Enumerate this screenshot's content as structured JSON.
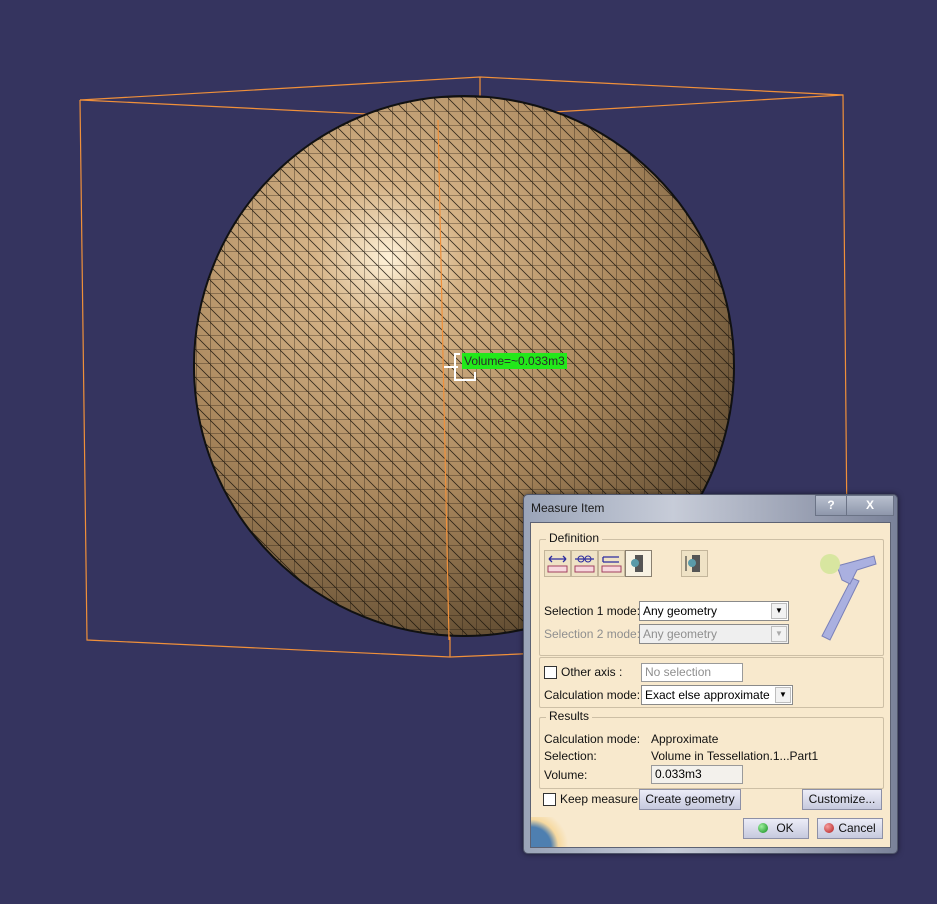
{
  "viewport": {
    "background": "#35345f",
    "measure_tag": "Volume=~0.033m3",
    "object_label": "sphere-tessellation",
    "bbox_color": "#f0903a"
  },
  "dialog": {
    "title": "Measure Item",
    "help_button": "?",
    "close_button": "X",
    "definition": {
      "label": "Definition",
      "tools": [
        {
          "name": "measure-between-icon",
          "active": false
        },
        {
          "name": "measure-between-in-chain-icon",
          "active": false
        },
        {
          "name": "measure-between-fan-icon",
          "active": false
        },
        {
          "name": "measure-item-icon",
          "active": true
        },
        {
          "name": "measure-thickness-icon",
          "active": false
        }
      ],
      "selection1_label": "Selection 1 mode:",
      "selection1_value": "Any geometry",
      "selection2_label": "Selection 2 mode:",
      "selection2_value": "Any geometry",
      "other_axis_label": "Other axis :",
      "other_axis_checked": false,
      "other_axis_value": "No selection",
      "calc_mode_label": "Calculation mode:",
      "calc_mode_value": "Exact else approximate"
    },
    "results": {
      "label": "Results",
      "calc_mode_label": "Calculation mode:",
      "calc_mode_value": "Approximate",
      "selection_label": "Selection:",
      "selection_value": "Volume in Tessellation.1...Part1",
      "volume_label": "Volume:",
      "volume_value": "0.033m3"
    },
    "keep_measure_label": "Keep measure",
    "keep_measure_checked": false,
    "create_geometry_label": "Create geometry",
    "customize_label": "Customize...",
    "ok_label": "OK",
    "cancel_label": "Cancel"
  }
}
